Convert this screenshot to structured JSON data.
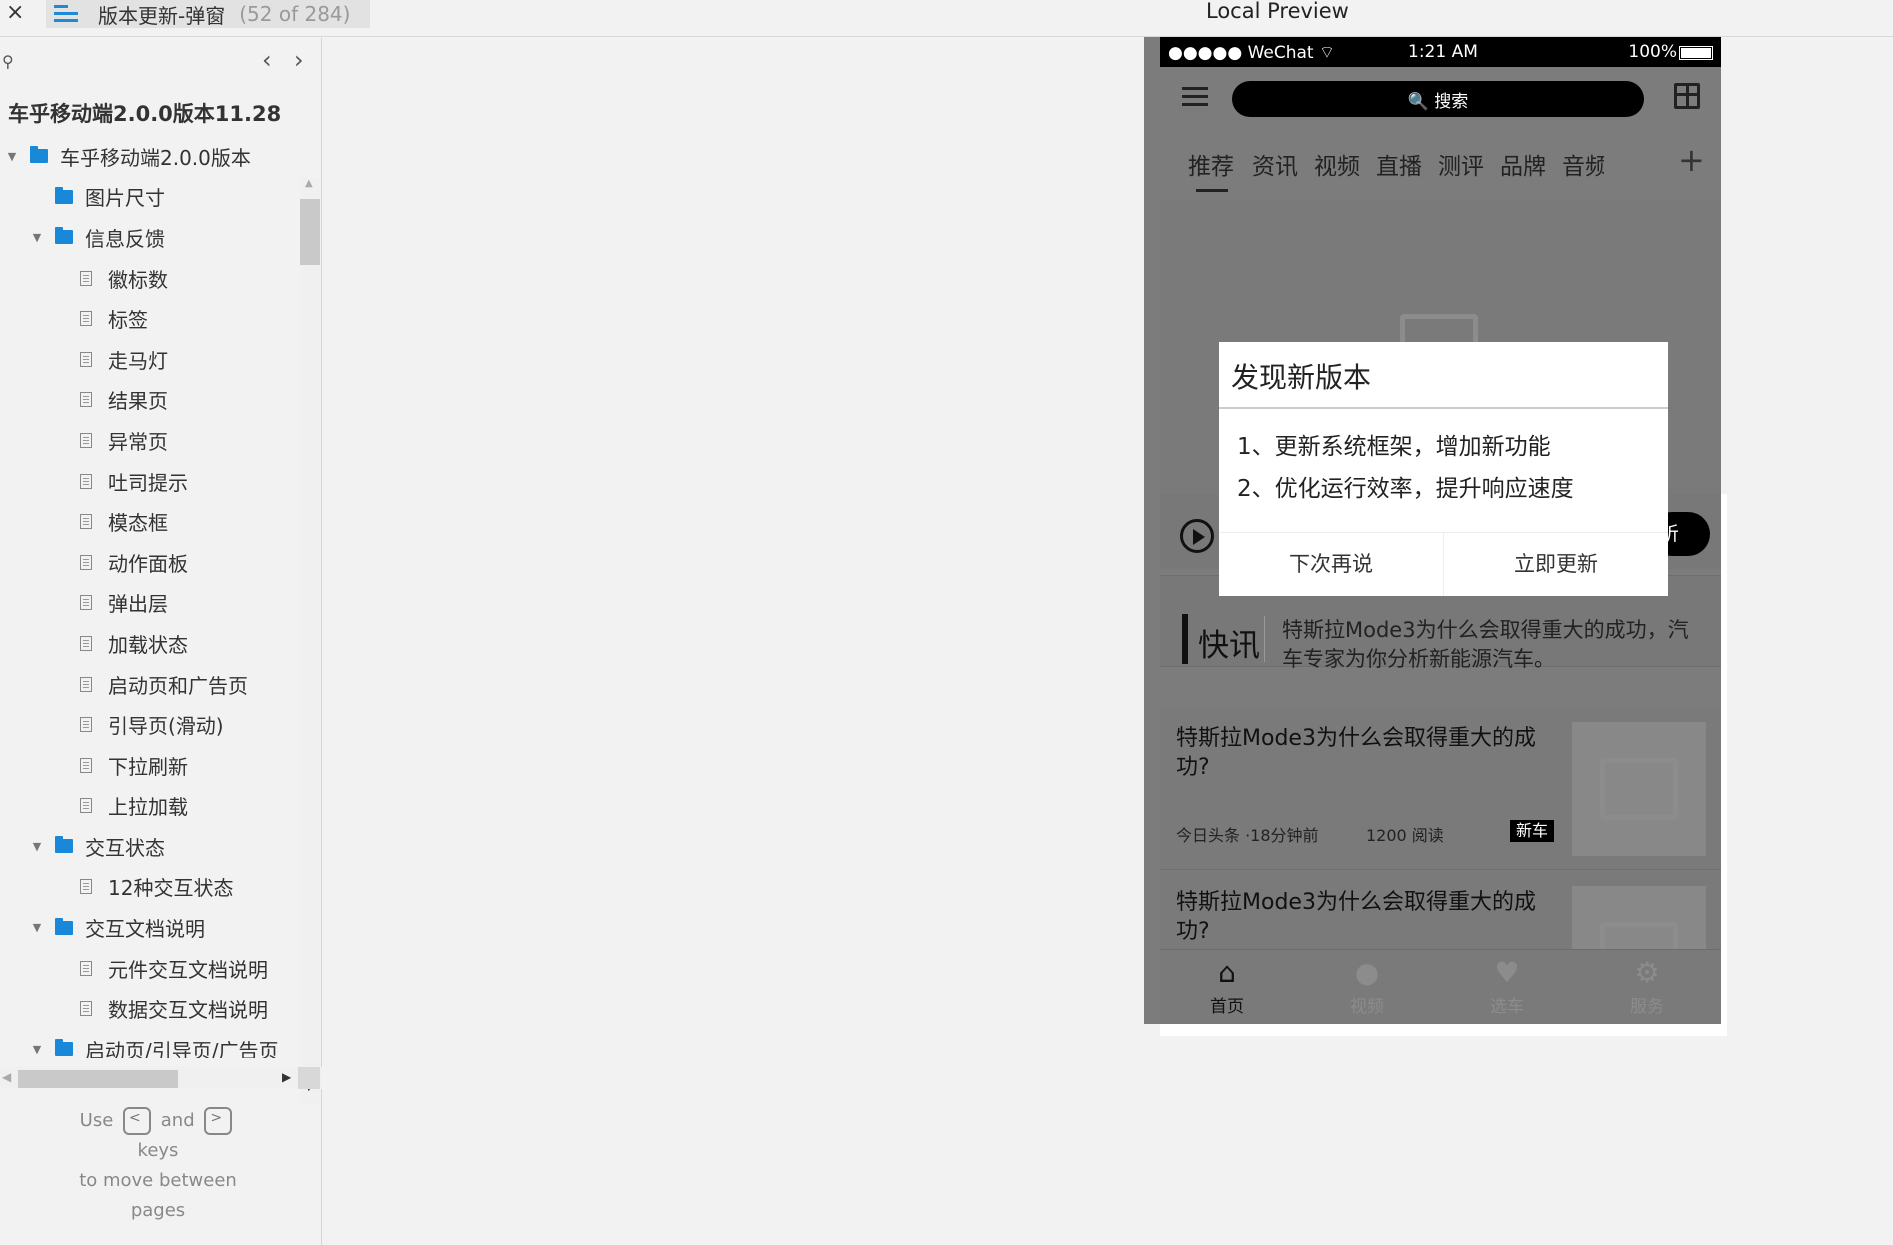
{
  "toolbar": {
    "close_label": "×",
    "tab_title": "版本更新-弹窗",
    "tab_count": "(52 of 284)",
    "preview_title": "Local Preview"
  },
  "sidebar": {
    "search_icon": "search-icon",
    "prev_label": "‹",
    "next_label": "›",
    "project_title": "车乎移动端2.0.0版本11.28",
    "tree": [
      {
        "label": "车乎移动端2.0.0版本",
        "type": "folder",
        "level": 0,
        "expanded": true
      },
      {
        "label": "图片尺寸",
        "type": "folder",
        "level": 1,
        "expanded": false
      },
      {
        "label": "信息反馈",
        "type": "folder",
        "level": 1,
        "expanded": true
      },
      {
        "label": "徽标数",
        "type": "page",
        "level": 2
      },
      {
        "label": "标签",
        "type": "page",
        "level": 2
      },
      {
        "label": "走马灯",
        "type": "page",
        "level": 2
      },
      {
        "label": "结果页",
        "type": "page",
        "level": 2
      },
      {
        "label": "异常页",
        "type": "page",
        "level": 2
      },
      {
        "label": "吐司提示",
        "type": "page",
        "level": 2
      },
      {
        "label": "模态框",
        "type": "page",
        "level": 2
      },
      {
        "label": "动作面板",
        "type": "page",
        "level": 2
      },
      {
        "label": "弹出层",
        "type": "page",
        "level": 2
      },
      {
        "label": "加载状态",
        "type": "page",
        "level": 2
      },
      {
        "label": "启动页和广告页",
        "type": "page",
        "level": 2
      },
      {
        "label": "引导页(滑动)",
        "type": "page",
        "level": 2
      },
      {
        "label": "下拉刷新",
        "type": "page",
        "level": 2
      },
      {
        "label": "上拉加载",
        "type": "page",
        "level": 2
      },
      {
        "label": "交互状态",
        "type": "folder",
        "level": 1,
        "expanded": true
      },
      {
        "label": "12种交互状态",
        "type": "page",
        "level": 2
      },
      {
        "label": "交互文档说明",
        "type": "folder",
        "level": 1,
        "expanded": true
      },
      {
        "label": "元件交互文档说明",
        "type": "page",
        "level": 2
      },
      {
        "label": "数据交互文档说明",
        "type": "page",
        "level": 2
      },
      {
        "label": "启动页/引导页/广告页",
        "type": "folder",
        "level": 1,
        "expanded": true
      }
    ],
    "help": {
      "use": "Use",
      "key_prev": "<",
      "and": "and",
      "key_next": ">",
      "keys": "keys",
      "line2": "to move between",
      "line3": "pages"
    }
  },
  "phone": {
    "status": {
      "carrier": "●●●●● WeChat ⌔",
      "time": "1:21 AM",
      "battery": "100%"
    },
    "search_placeholder": "🔍 搜索",
    "categories": [
      "推荐",
      "资讯",
      "视频",
      "直播",
      "测评",
      "品牌",
      "音频"
    ],
    "listen_label": "听",
    "kuaixun_label": "快讯",
    "kuaixun_text": "特斯拉Mode3为什么会取得重大的成功，汽车专家为你分析新能源汽车。",
    "news": [
      {
        "title": "特斯拉Mode3为什么会取得重大的成功?",
        "source": "今日头条 ·18分钟前",
        "reads": "1200 阅读",
        "tag": "新车"
      },
      {
        "title": "特斯拉Mode3为什么会取得重大的成功?"
      }
    ],
    "tabbar": [
      {
        "label": "首页",
        "icon": "home-icon",
        "active": true
      },
      {
        "label": "视频",
        "icon": "chat-icon",
        "active": false
      },
      {
        "label": "选车",
        "icon": "heart-icon",
        "active": false
      },
      {
        "label": "服务",
        "icon": "gear-icon",
        "active": false
      }
    ]
  },
  "modal": {
    "title": "发现新版本",
    "lines": [
      "1、更新系统框架，增加新功能",
      "2、优化运行效率，提升响应速度"
    ],
    "later_label": "下次再说",
    "update_label": "立即更新"
  }
}
